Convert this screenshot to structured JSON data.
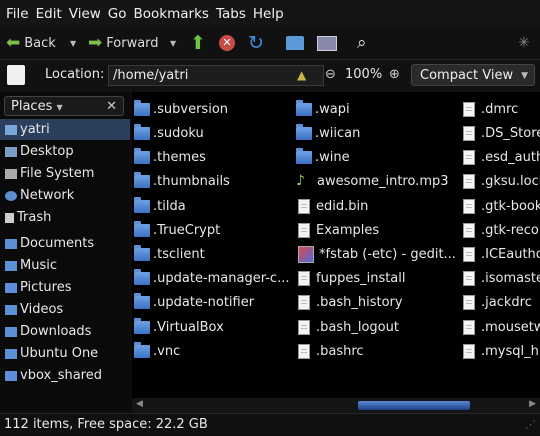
{
  "menu": [
    "File",
    "Edit",
    "View",
    "Go",
    "Bookmarks",
    "Tabs",
    "Help"
  ],
  "toolbar": {
    "back": "Back",
    "forward": "Forward"
  },
  "location": {
    "label": "Location:",
    "path": "/home/yatri",
    "zoom": "100%",
    "view": "Compact View"
  },
  "sidebar": {
    "header": "Places",
    "items": [
      "yatri",
      "Desktop",
      "File System",
      "Network",
      "Trash",
      "Documents",
      "Music",
      "Pictures",
      "Videos",
      "Downloads",
      "Ubuntu One",
      "vbox_shared"
    ]
  },
  "files": {
    "col1": [
      ".subversion",
      ".sudoku",
      ".themes",
      ".thumbnails",
      ".tilda",
      ".TrueCrypt",
      ".tsclient",
      ".update-manager-c...",
      ".update-notifier",
      ".VirtualBox",
      ".vnc"
    ],
    "col2": [
      ".wapi",
      ".wiican",
      ".wine",
      "awesome_intro.mp3",
      "edid.bin",
      "Examples",
      "*fstab (-etc) - gedit...",
      "fuppes_install",
      ".bash_history",
      ".bash_logout",
      ".bashrc"
    ],
    "col3": [
      ".dmrc",
      ".DS_Store",
      ".esd_auth",
      ".gksu.lock",
      ".gtk-book",
      ".gtk-recor",
      ".ICEautho",
      ".isomaste",
      ".jackdrc",
      ".mousetw",
      ".mysql_his"
    ]
  },
  "status": "112 items, Free space: 22.2 GB"
}
